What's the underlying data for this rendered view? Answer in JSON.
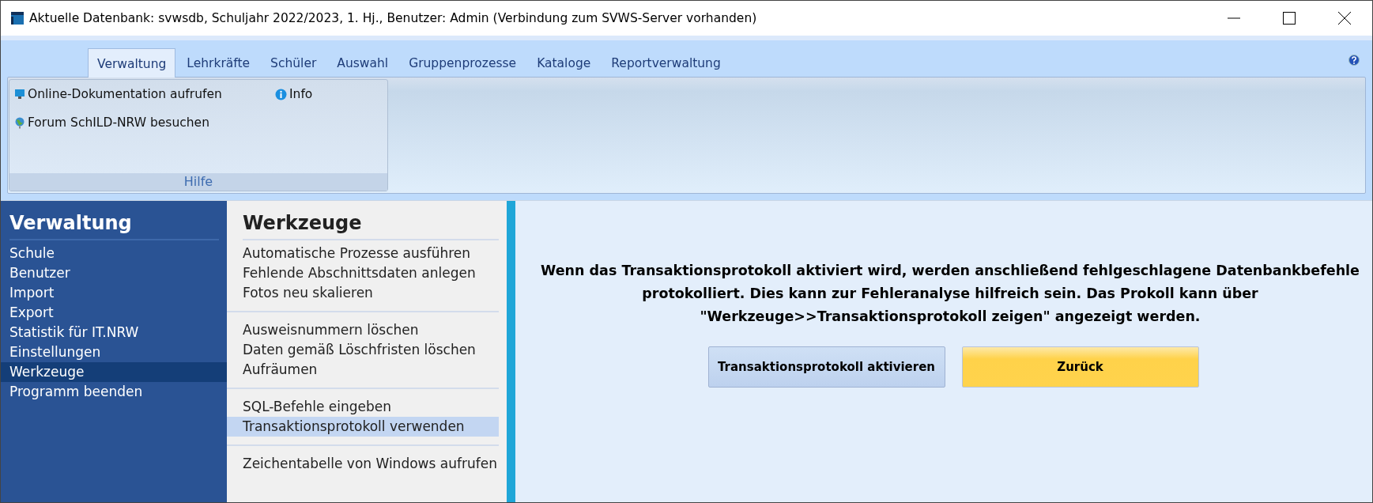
{
  "window": {
    "title": "Aktuelle Datenbank: svwsdb, Schuljahr 2022/2023, 1. Hj., Benutzer: Admin (Verbindung zum SVWS-Server vorhanden)"
  },
  "ribbon_tabs": [
    {
      "label": "Verwaltung",
      "selected": true
    },
    {
      "label": "Lehrkräfte",
      "selected": false
    },
    {
      "label": "Schüler",
      "selected": false
    },
    {
      "label": "Auswahl",
      "selected": false
    },
    {
      "label": "Gruppenprozesse",
      "selected": false
    },
    {
      "label": "Kataloge",
      "selected": false
    },
    {
      "label": "Reportverwaltung",
      "selected": false
    }
  ],
  "ribbon_group": {
    "label": "Hilfe",
    "items": [
      {
        "label": "Online-Dokumentation aufrufen",
        "kind": "monitor"
      },
      {
        "label": "Info",
        "kind": "info"
      },
      {
        "label": "Forum SchILD-NRW besuchen",
        "kind": "globe"
      }
    ]
  },
  "sidebar": {
    "title": "Verwaltung",
    "items": [
      {
        "label": "Schule",
        "selected": false
      },
      {
        "label": "Benutzer",
        "selected": false
      },
      {
        "label": "Import",
        "selected": false
      },
      {
        "label": "Export",
        "selected": false
      },
      {
        "label": "Statistik für IT.NRW",
        "selected": false
      },
      {
        "label": "Einstellungen",
        "selected": false
      },
      {
        "label": "Werkzeuge",
        "selected": true
      },
      {
        "label": "Programm beenden",
        "selected": false
      }
    ]
  },
  "submenu": {
    "title": "Werkzeuge",
    "groups": [
      [
        {
          "label": "Automatische Prozesse ausführen",
          "selected": false
        },
        {
          "label": "Fehlende Abschnittsdaten anlegen",
          "selected": false
        },
        {
          "label": "Fotos neu skalieren",
          "selected": false
        }
      ],
      [
        {
          "label": "Ausweisnummern löschen",
          "selected": false
        },
        {
          "label": "Daten gemäß Löschfristen löschen",
          "selected": false
        },
        {
          "label": "Aufräumen",
          "selected": false
        }
      ],
      [
        {
          "label": "SQL-Befehle eingeben",
          "selected": false
        },
        {
          "label": "Transaktionsprotokoll verwenden",
          "selected": true
        }
      ],
      [
        {
          "label": "Zeichentabelle von Windows aufrufen",
          "selected": false
        }
      ]
    ]
  },
  "content": {
    "message": "Wenn das Transaktionsprotokoll aktiviert wird, werden anschließend fehlgeschlagene Datenbankbefehle protokolliert. Dies kann zur Fehleranalyse hilfreich sein. Das Prokoll kann über \"Werkzeuge>>Transaktionsprotokoll zeigen\" angezeigt werden.",
    "buttons": [
      {
        "label": "Transaktionsprotokoll aktivieren",
        "kind": "normal"
      },
      {
        "label": "Zurück",
        "kind": "primary"
      }
    ]
  }
}
